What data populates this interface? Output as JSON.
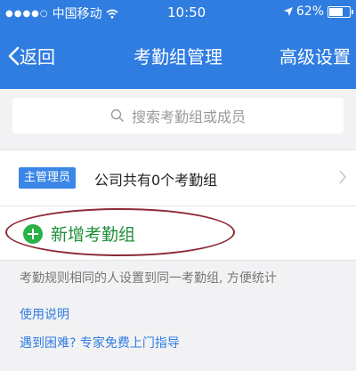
{
  "status": {
    "carrier": "中国移动",
    "time": "10:50",
    "battery": "62%",
    "battery_level": 0.62,
    "icons": [
      "signal-dots-icon",
      "wifi-icon",
      "location-arrow-icon",
      "battery-icon"
    ]
  },
  "nav": {
    "back_label": "返回",
    "title": "考勤组管理",
    "right_label": "高级设置",
    "bg_color": "#2f7de1"
  },
  "search": {
    "placeholder": "搜索考勤组或成员"
  },
  "admin_row": {
    "badge": "主管理员",
    "text": "公司共有0个考勤组"
  },
  "new_group": {
    "label": "新增考勤组",
    "accent": "#2ab24a",
    "highlight_color": "#8d2a35"
  },
  "hint": "考勤规则相同的人设置到同一考勤组, 方便统计",
  "links": {
    "guide": "使用说明",
    "help": "遇到困难? 专家免费上门指导"
  }
}
